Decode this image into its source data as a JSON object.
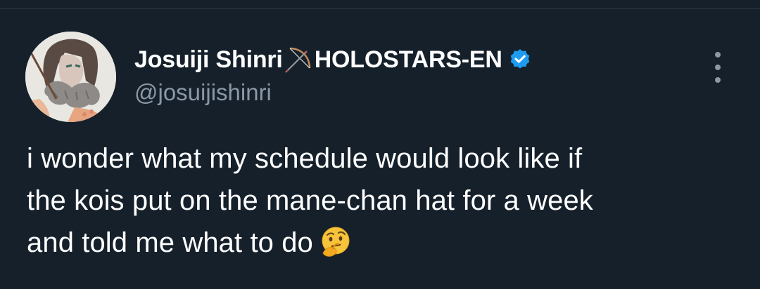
{
  "tweet": {
    "author": {
      "display_name": "Josuiji Shinri",
      "display_name_suffix": "HOLOSTARS-EN",
      "name_emoji": "bow-and-arrow-icon",
      "verified_badge": "verified-icon",
      "handle": "@josuijishinri"
    },
    "more_options": "more-options-icon",
    "text_lines": [
      "i wonder what my schedule would look like if",
      "the kois put on the mane-chan hat for a week",
      "and told me what to do"
    ],
    "trailing_emoji": "thinking-face-icon"
  },
  "colors": {
    "background": "#15202b",
    "text_primary": "#ffffff",
    "text_secondary": "#8b98a5",
    "verified_blue": "#1d9bf0",
    "divider": "#2b3640"
  }
}
